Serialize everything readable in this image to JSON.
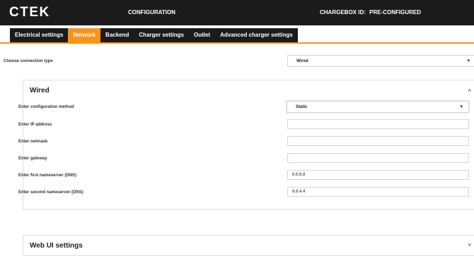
{
  "header": {
    "logo": "CTEK",
    "title": "CONFIGURATION",
    "chargebox_label": "CHARGEBOX ID:",
    "chargebox_value": "PRE-CONFIGURED"
  },
  "tabs": [
    {
      "label": "Electrical settings",
      "active": false
    },
    {
      "label": "Network",
      "active": true
    },
    {
      "label": "Backend",
      "active": false
    },
    {
      "label": "Charger settings",
      "active": false
    },
    {
      "label": "Outlet",
      "active": false
    },
    {
      "label": "Advanced charger settings",
      "active": false
    }
  ],
  "connection": {
    "label": "Choose connection type",
    "value": "Wired"
  },
  "wired_panel": {
    "title": "Wired",
    "method_label": "Enter configuration method",
    "method_value": "Static",
    "ip_label": "Enter IP address",
    "ip_value": "",
    "netmask_label": "Enter netmask",
    "netmask_value": "",
    "gateway_label": "Enter gateway",
    "gateway_value": "",
    "dns1_label": "Enter first nameserver (DNS)",
    "dns1_value": "8.8.8.8",
    "dns2_label": "Enter second nameserver (DNS)",
    "dns2_value": "8.8.4.4"
  },
  "webui_panel": {
    "title": "Web UI settings"
  },
  "colors": {
    "accent": "#f7941d",
    "header_bg": "#1b1b1b"
  },
  "icons": {
    "caret": "caret-down-icon",
    "collapse": "chevron-up-icon",
    "expand": "chevron-down-icon"
  }
}
